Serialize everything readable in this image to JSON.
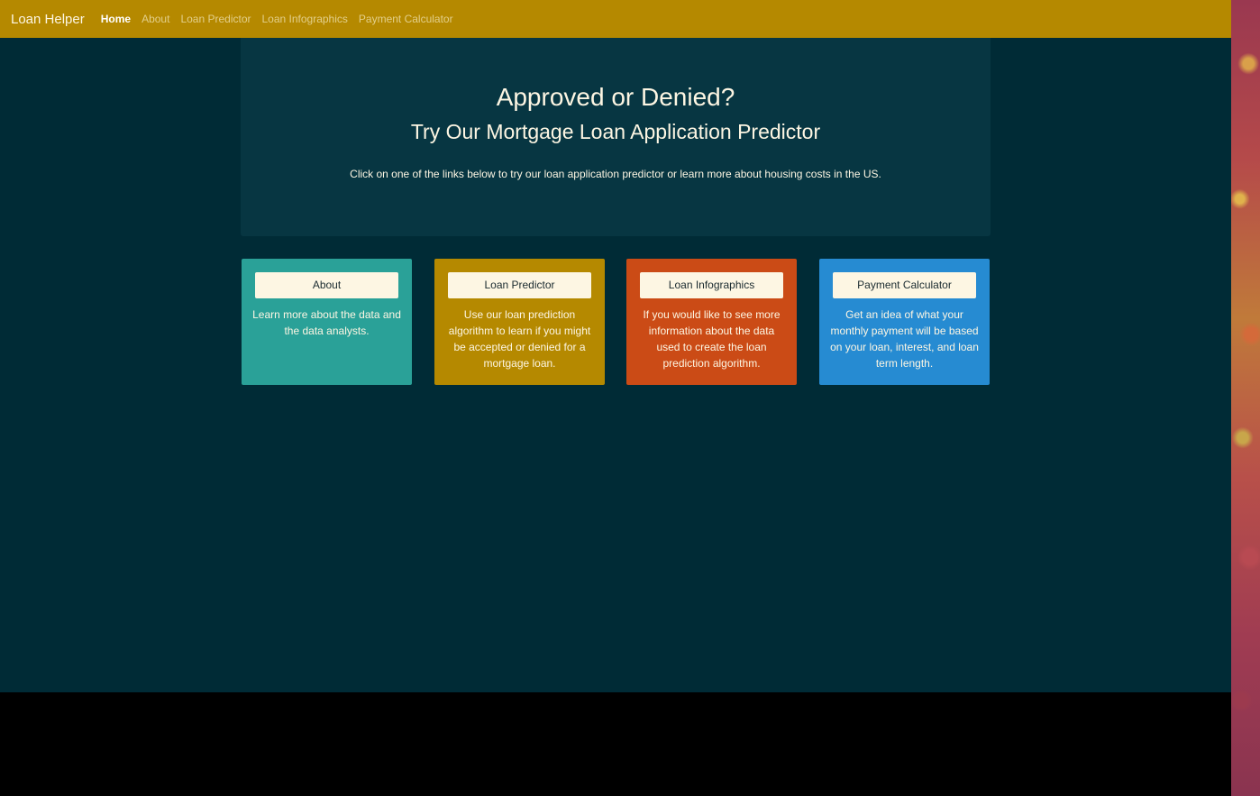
{
  "navbar": {
    "brand": "Loan Helper",
    "links": [
      {
        "label": "Home",
        "active": true
      },
      {
        "label": "About",
        "active": false
      },
      {
        "label": "Loan Predictor",
        "active": false
      },
      {
        "label": "Loan Infographics",
        "active": false
      },
      {
        "label": "Payment Calculator",
        "active": false
      }
    ]
  },
  "hero": {
    "title": "Approved or Denied?",
    "subtitle": "Try Our Mortgage Loan Application Predictor",
    "text": "Click on one of the links below to try our loan application predictor or learn more about housing costs in the US."
  },
  "cards": [
    {
      "button": "About",
      "description": "Learn more about the data and the data analysts.",
      "color": "#2aa198"
    },
    {
      "button": "Loan Predictor",
      "description": "Use our loan prediction algorithm to learn if you might be accepted or denied for a mortgage loan.",
      "color": "#b58900"
    },
    {
      "button": "Loan Infographics",
      "description": "If you would like to see more information about the data used to create the loan prediction algorithm.",
      "color": "#cb4b16"
    },
    {
      "button": "Payment Calculator",
      "description": "Get an idea of what your monthly payment will be based on your loan, interest, and loan term length.",
      "color": "#268bd2"
    }
  ],
  "colors": {
    "navbar": "#b58900",
    "background": "#002b36",
    "hero": "#073642",
    "text": "#fdf6e3"
  }
}
